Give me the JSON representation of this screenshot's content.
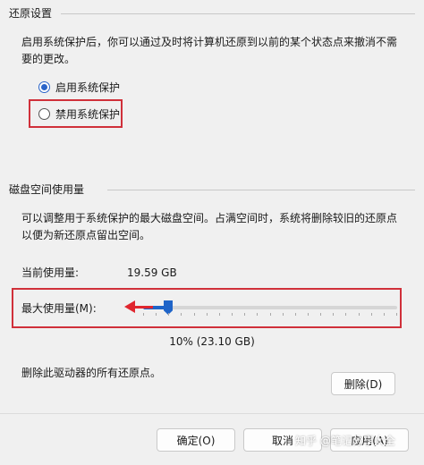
{
  "restore": {
    "title": "还原设置",
    "description": "启用系统保护后，你可以通过及时将计算机还原到以前的某个状态点来撤消不需要的更改。",
    "options": [
      {
        "label": "启用系统保护",
        "checked": true
      },
      {
        "label": "禁用系统保护",
        "checked": false
      }
    ]
  },
  "disk": {
    "title": "磁盘空间使用量",
    "description": "可以调整用于系统保护的最大磁盘空间。占满空间时，系统将删除较旧的还原点以便为新还原点留出空间。",
    "current_label": "当前使用量:",
    "current_value": "19.59 GB",
    "max_label": "最大使用量(M):",
    "slider_fraction": 0.1,
    "max_value": "10% (23.10 GB)"
  },
  "delete": {
    "text": "删除此驱动器的所有还原点。",
    "button": "删除(D)"
  },
  "footer": {
    "ok": "确定(O)",
    "cancel": "取消",
    "apply": "应用(A)"
  },
  "watermark": "知乎 @笔记分享大全",
  "colors": {
    "accent": "#1f64c8",
    "highlight": "#d0303a"
  }
}
